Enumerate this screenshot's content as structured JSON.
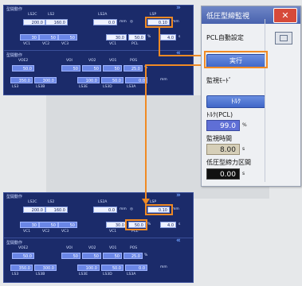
{
  "panel_titles": {
    "setup": "型開動作",
    "motion": "型開動作"
  },
  "top_panel": {
    "labels_row1": [
      "LS2C",
      "LS2",
      "LS2A",
      "LSP"
    ],
    "fields_row1": [
      "200.0",
      "160.0",
      "0.0",
      "0.10"
    ],
    "mm": "mm",
    "row2_labels": [
      "VC1",
      "VC2",
      "VC3",
      "VC1",
      "PCL"
    ],
    "fields_row2": [
      "30",
      "50",
      "50",
      "30.0",
      "50.0",
      "4.0"
    ],
    "percent": "%",
    "s_unit": "s"
  },
  "bottom_panel": {
    "labels": [
      "VOE2",
      "VOI",
      "VO2",
      "VO1",
      "POS"
    ],
    "fields_row1": [
      "50.0",
      "50",
      "50",
      "50",
      "25.0"
    ],
    "fields_row2": [
      "350.0",
      "300.0",
      "100.0",
      "50.0",
      "0.0"
    ],
    "ls_labels": [
      "LS3",
      "LS3B",
      "LS3E",
      "LS3D",
      "LS3A"
    ],
    "mm": "mm"
  },
  "dialog": {
    "title": "低圧型締監視",
    "close": "✕",
    "pcl_auto_label": "PCL自動設定",
    "execute_button": "実行",
    "monitor_mode_label": "監視ﾓｰﾄﾞ",
    "torque_button": "ﾄﾙｸ",
    "torque_pcl_label": "ﾄﾙｸ(PCL)",
    "torque_pcl_value": "99.0",
    "percent": "%",
    "monitor_time_label": "監視時間",
    "monitor_time_value": "8.00",
    "s_unit": "s",
    "low_pressure_section_label": "低圧型締力区間",
    "low_pressure_section_value": "0.00"
  },
  "colors": {
    "orange": "#f08a24",
    "panel_blue": "#1b2b6a",
    "close_red": "#d64a3a"
  }
}
